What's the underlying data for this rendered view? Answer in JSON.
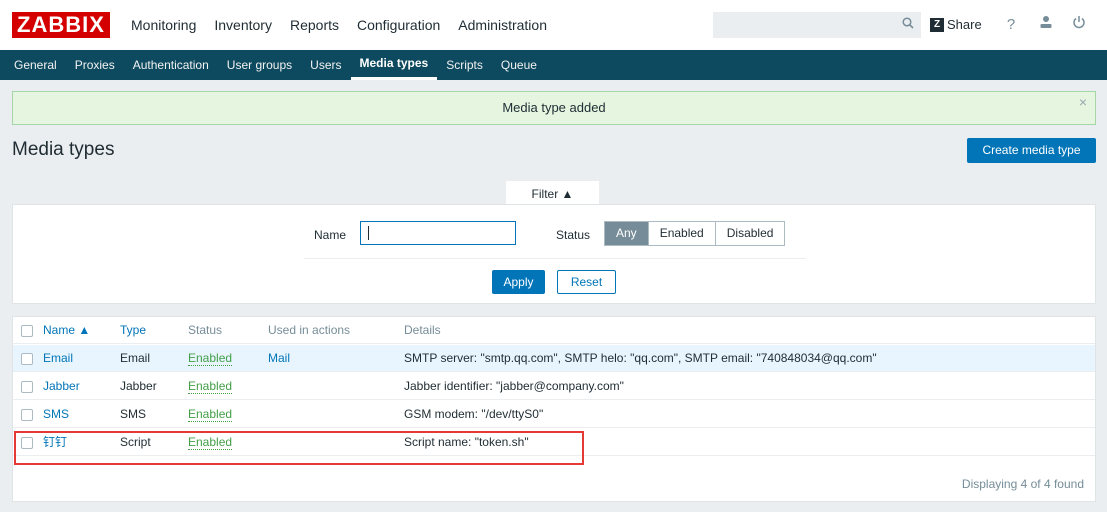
{
  "header": {
    "logo": "ZABBIX",
    "menu": [
      "Monitoring",
      "Inventory",
      "Reports",
      "Configuration",
      "Administration"
    ],
    "share_label": "Share",
    "share_logo": "Z",
    "icons": [
      "search-icon",
      "help-icon",
      "user-icon",
      "power-icon"
    ]
  },
  "subnav": [
    "General",
    "Proxies",
    "Authentication",
    "User groups",
    "Users",
    "Media types",
    "Scripts",
    "Queue"
  ],
  "message": "Media type added",
  "page_title": "Media types",
  "create_button": "Create media type",
  "filter": {
    "tab_label": "Filter ▲",
    "name_label": "Name",
    "name_value": "",
    "status_label": "Status",
    "status_options": [
      "Any",
      "Enabled",
      "Disabled"
    ],
    "status_selected": "Any",
    "apply": "Apply",
    "reset": "Reset"
  },
  "table": {
    "headers": [
      "Name ▲",
      "Type",
      "Status",
      "Used in actions",
      "Details"
    ],
    "rows": [
      {
        "name": "Email",
        "type": "Email",
        "status": "Enabled",
        "actions": "Mail",
        "details": "SMTP server: \"smtp.qq.com\", SMTP helo: \"qq.com\", SMTP email: \"740848034@qq.com\""
      },
      {
        "name": "Jabber",
        "type": "Jabber",
        "status": "Enabled",
        "actions": "",
        "details": "Jabber identifier: \"jabber@company.com\""
      },
      {
        "name": "SMS",
        "type": "SMS",
        "status": "Enabled",
        "actions": "",
        "details": "GSM modem: \"/dev/ttyS0\""
      },
      {
        "name": "钉钉",
        "type": "Script",
        "status": "Enabled",
        "actions": "",
        "details": "Script name: \"token.sh\""
      }
    ],
    "footer": "Displaying 4 of 4 found"
  },
  "colors": {
    "brand": "#d40000",
    "nav": "#0e4a5f",
    "accent": "#0275b8",
    "enabled": "#429e47",
    "highlight": "#e53935"
  }
}
